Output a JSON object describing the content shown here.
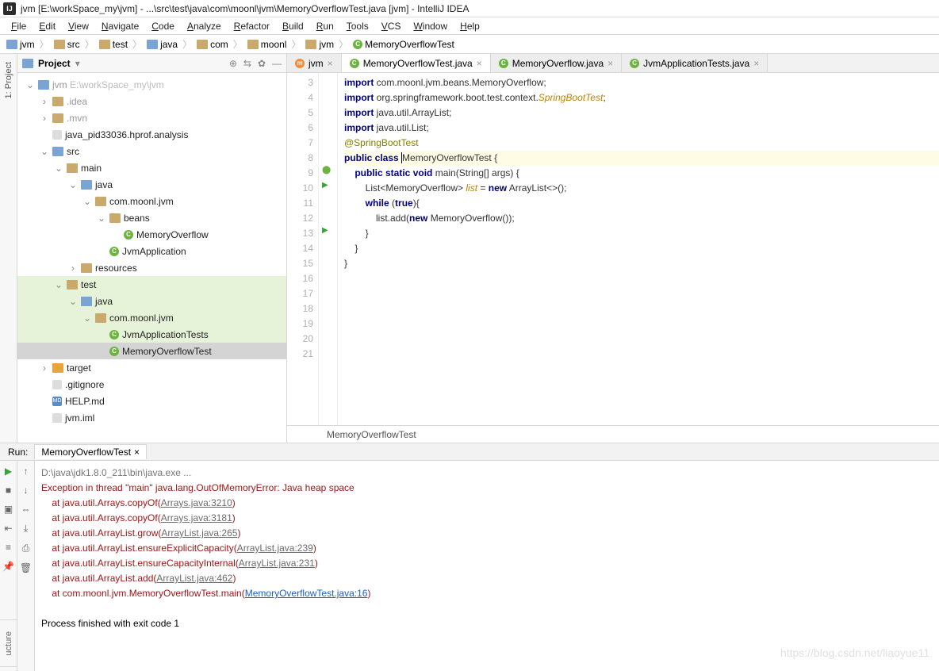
{
  "title": "jvm [E:\\workSpace_my\\jvm] - ...\\src\\test\\java\\com\\moonl\\jvm\\MemoryOverflowTest.java [jvm] - IntelliJ IDEA",
  "menu": [
    "File",
    "Edit",
    "View",
    "Navigate",
    "Code",
    "Analyze",
    "Refactor",
    "Build",
    "Run",
    "Tools",
    "VCS",
    "Window",
    "Help"
  ],
  "breadcrumbs": [
    "jvm",
    "src",
    "test",
    "java",
    "com",
    "moonl",
    "jvm",
    "MemoryOverflowTest"
  ],
  "projectPanel": {
    "title": "Project"
  },
  "tree": [
    {
      "indent": 0,
      "arrow": "open",
      "icon": "folder-blue",
      "label": "jvm",
      "suffix": " E:\\workSpace_my\\jvm",
      "muted": true
    },
    {
      "indent": 1,
      "arrow": "closed",
      "icon": "folder",
      "label": ".idea",
      "muted": true
    },
    {
      "indent": 1,
      "arrow": "closed",
      "icon": "folder",
      "label": ".mvn",
      "muted": true
    },
    {
      "indent": 1,
      "arrow": "none",
      "icon": "file",
      "label": "java_pid33036.hprof.analysis"
    },
    {
      "indent": 1,
      "arrow": "open",
      "icon": "folder-blue",
      "label": "src"
    },
    {
      "indent": 2,
      "arrow": "open",
      "icon": "folder",
      "label": "main"
    },
    {
      "indent": 3,
      "arrow": "open",
      "icon": "folder-blue",
      "label": "java"
    },
    {
      "indent": 4,
      "arrow": "open",
      "icon": "folder",
      "label": "com.moonl.jvm"
    },
    {
      "indent": 5,
      "arrow": "open",
      "icon": "folder",
      "label": "beans"
    },
    {
      "indent": 6,
      "arrow": "none",
      "icon": "class-c",
      "label": "MemoryOverflow"
    },
    {
      "indent": 5,
      "arrow": "none",
      "icon": "class-c",
      "label": "JvmApplication"
    },
    {
      "indent": 3,
      "arrow": "closed",
      "icon": "folder",
      "label": "resources"
    },
    {
      "indent": 2,
      "arrow": "open",
      "icon": "folder",
      "label": "test",
      "hl": true
    },
    {
      "indent": 3,
      "arrow": "open",
      "icon": "folder-blue",
      "label": "java",
      "hl": true
    },
    {
      "indent": 4,
      "arrow": "open",
      "icon": "folder",
      "label": "com.moonl.jvm",
      "hl": true
    },
    {
      "indent": 5,
      "arrow": "none",
      "icon": "class-c",
      "label": "JvmApplicationTests",
      "hl": true
    },
    {
      "indent": 5,
      "arrow": "none",
      "icon": "class-c",
      "label": "MemoryOverflowTest",
      "sel": true
    },
    {
      "indent": 1,
      "arrow": "closed",
      "icon": "folder-orange",
      "label": "target"
    },
    {
      "indent": 1,
      "arrow": "none",
      "icon": "file",
      "label": ".gitignore"
    },
    {
      "indent": 1,
      "arrow": "none",
      "icon": "file-md",
      "label": "HELP.md"
    },
    {
      "indent": 1,
      "arrow": "none",
      "icon": "file",
      "label": "jvm.iml"
    }
  ],
  "tabs": [
    {
      "icon": "m",
      "label": "jvm"
    },
    {
      "icon": "c",
      "label": "MemoryOverflowTest.java",
      "active": true
    },
    {
      "icon": "c",
      "label": "MemoryOverflow.java"
    },
    {
      "icon": "c",
      "label": "JvmApplicationTests.java"
    }
  ],
  "code": {
    "firstLine": 3,
    "lines": [
      {
        "n": 3,
        "html": "<span class='kw'>import</span> com.moonl.jvm.beans.MemoryOverflow;"
      },
      {
        "n": 4,
        "html": "<span class='kw'>import</span> org.springframework.boot.test.context.<span class='gold'>SpringBootTest</span>;"
      },
      {
        "n": 5,
        "html": ""
      },
      {
        "n": 6,
        "html": "<span class='kw'>import</span> java.util.ArrayList;"
      },
      {
        "n": 7,
        "html": "<span class='kw'>import</span> java.util.List;"
      },
      {
        "n": 8,
        "html": ""
      },
      {
        "n": 9,
        "html": "<span class='ann'>@SpringBootTest</span>",
        "leaf": true
      },
      {
        "n": 10,
        "html": "<span class='kw'>public class</span> <span class='caret'></span>MemoryOverflowTest {",
        "run": true,
        "hl": true
      },
      {
        "n": 11,
        "html": ""
      },
      {
        "n": 12,
        "html": ""
      },
      {
        "n": 13,
        "html": "    <span class='kw'>public static void</span> main(String[] args) {",
        "run": true
      },
      {
        "n": 14,
        "html": "        List&lt;MemoryOverflow&gt; <span class='gold'>list</span> = <span class='kw'>new</span> ArrayList&lt;&gt;();"
      },
      {
        "n": 15,
        "html": "        <span class='kw'>while</span> (<span class='kw'>true</span>){"
      },
      {
        "n": 16,
        "html": "            list.add(<span class='kw'>new</span> MemoryOverflow());"
      },
      {
        "n": 17,
        "html": "        }"
      },
      {
        "n": 18,
        "html": ""
      },
      {
        "n": 19,
        "html": "    }"
      },
      {
        "n": 20,
        "html": "}"
      },
      {
        "n": 21,
        "html": ""
      }
    ]
  },
  "editorCrumb": "MemoryOverflowTest",
  "run": {
    "label": "Run:",
    "tab": "MemoryOverflowTest",
    "cmd": "D:\\java\\jdk1.8.0_211\\bin\\java.exe ...",
    "exception": "Exception in thread \"main\" java.lang.OutOfMemoryError: Java heap space",
    "stack": [
      {
        "at": "at java.util.Arrays.copyOf",
        "loc": "Arrays.java:3210"
      },
      {
        "at": "at java.util.Arrays.copyOf",
        "loc": "Arrays.java:3181"
      },
      {
        "at": "at java.util.ArrayList.grow",
        "loc": "ArrayList.java:265"
      },
      {
        "at": "at java.util.ArrayList.ensureExplicitCapacity",
        "loc": "ArrayList.java:239"
      },
      {
        "at": "at java.util.ArrayList.ensureCapacityInternal",
        "loc": "ArrayList.java:231"
      },
      {
        "at": "at java.util.ArrayList.add",
        "loc": "ArrayList.java:462"
      },
      {
        "at": "at com.moonl.jvm.MemoryOverflowTest.main",
        "loc": "MemoryOverflowTest.java:16",
        "blue": true
      }
    ],
    "exit": "Process finished with exit code 1"
  },
  "sideLabel": "1: Project",
  "structLabel": "ucture",
  "watermark": "https://blog.csdn.net/liaoyue11"
}
